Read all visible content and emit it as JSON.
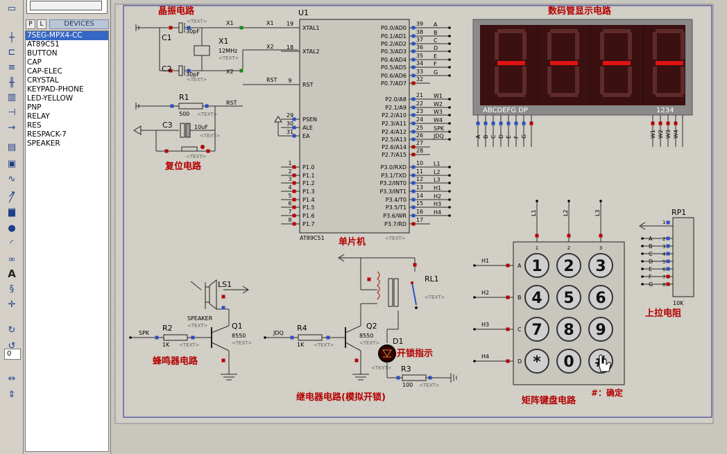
{
  "toolbar": {
    "icons": [
      "component-mode-icon",
      "junction-icon",
      "wire-label-icon",
      "text-script-icon",
      "bus-icon",
      "subcircuit-icon",
      "terminal-icon",
      "pin-icon",
      "graph-icon",
      "tape-icon",
      "generator-icon",
      "probe-icon",
      "virtual-instrument-icon",
      "line-icon",
      "box-icon",
      "circle-icon",
      "arc-icon",
      "path-icon",
      "text-icon",
      "symbol-icon",
      "marker-icon",
      "rotate-cw-icon",
      "rotate-ccw-icon",
      "flip-horizontal-icon",
      "flip-vertical-icon"
    ],
    "text_icon_label": "A",
    "rotation_value": "0"
  },
  "device_panel": {
    "tab_p": "P",
    "tab_l": "L",
    "title": "DEVICES",
    "devices": [
      "7SEG-MPX4-CC",
      "AT89C51",
      "BUTTON",
      "CAP",
      "CAP-ELEC",
      "CRYSTAL",
      "KEYPAD-PHONE",
      "LED-YELLOW",
      "PNP",
      "RELAY",
      "RES",
      "RESPACK-7",
      "SPEAKER"
    ],
    "selected_index": 0
  },
  "schematic": {
    "section_labels": {
      "crystal": "晶振电路",
      "display": "数码管显示电路",
      "reset": "复位电路",
      "mcu": "单片机",
      "buzzer": "蜂鸣器电路",
      "relay": "继电器电路(模拟开锁)",
      "keypad": "矩阵键盘电路",
      "pullup": "上拉电阻",
      "confirm": "#：确定",
      "led_indicator": "开锁指示"
    },
    "text_placeholder": "<TEXT>",
    "c1": {
      "ref": "C1",
      "value": "30pF"
    },
    "c2": {
      "ref": "C2",
      "value": "30pF"
    },
    "x1": {
      "ref": "X1",
      "value": "12MHz"
    },
    "r1": {
      "ref": "R1",
      "value": "500"
    },
    "c3": {
      "ref": "C3",
      "value": "10uF"
    },
    "net_x1": "X1",
    "net_x2": "X2",
    "net_rst": "RST",
    "mcu": {
      "ref": "U1",
      "part": "AT89C51",
      "left_pins": [
        {
          "num": "19",
          "name": "XTAL1",
          "net": "X1"
        },
        {
          "num": "18",
          "name": "XTAL2",
          "net": "X2"
        },
        {
          "num": "9",
          "name": "RST",
          "net": "RST"
        },
        {
          "num": "29",
          "name": "PSEN",
          "net": ""
        },
        {
          "num": "30",
          "name": "ALE",
          "net": ""
        },
        {
          "num": "31",
          "name": "EA",
          "net": ""
        },
        {
          "num": "1",
          "name": "P1.0",
          "net": ""
        },
        {
          "num": "2",
          "name": "P1.1",
          "net": ""
        },
        {
          "num": "3",
          "name": "P1.2",
          "net": ""
        },
        {
          "num": "4",
          "name": "P1.3",
          "net": ""
        },
        {
          "num": "5",
          "name": "P1.4",
          "net": ""
        },
        {
          "num": "6",
          "name": "P1.5",
          "net": ""
        },
        {
          "num": "7",
          "name": "P1.6",
          "net": ""
        },
        {
          "num": "8",
          "name": "P1.7",
          "net": ""
        }
      ],
      "right_pins": [
        {
          "num": "39",
          "name": "P0.0/AD0",
          "net": "A"
        },
        {
          "num": "38",
          "name": "P0.1/AD1",
          "net": "B"
        },
        {
          "num": "37",
          "name": "P0.2/AD2",
          "net": "C"
        },
        {
          "num": "36",
          "name": "P0.3/AD3",
          "net": "D"
        },
        {
          "num": "35",
          "name": "P0.4/AD4",
          "net": "E"
        },
        {
          "num": "34",
          "name": "P0.5/AD5",
          "net": "F"
        },
        {
          "num": "33",
          "name": "P0.6/AD6",
          "net": "G"
        },
        {
          "num": "32",
          "name": "P0.7/AD7",
          "net": ""
        },
        {
          "num": "21",
          "name": "P2.0/A8",
          "net": "W1"
        },
        {
          "num": "22",
          "name": "P2.1/A9",
          "net": "W2"
        },
        {
          "num": "23",
          "name": "P2.2/A10",
          "net": "W3"
        },
        {
          "num": "24",
          "name": "P2.3/A11",
          "net": "W4"
        },
        {
          "num": "25",
          "name": "P2.4/A12",
          "net": "SPK"
        },
        {
          "num": "26",
          "name": "P2.5/A13",
          "net": "JDQ"
        },
        {
          "num": "27",
          "name": "P2.6/A14",
          "net": ""
        },
        {
          "num": "28",
          "name": "P2.7/A15",
          "net": ""
        },
        {
          "num": "10",
          "name": "P3.0/RXD",
          "net": "L1"
        },
        {
          "num": "11",
          "name": "P3.1/TXD",
          "net": "L2"
        },
        {
          "num": "12",
          "name": "P3.2/INT0",
          "net": "L3"
        },
        {
          "num": "13",
          "name": "P3.3/INT1",
          "net": "H1"
        },
        {
          "num": "14",
          "name": "P3.4/T0",
          "net": "H2"
        },
        {
          "num": "15",
          "name": "P3.5/T1",
          "net": "H3"
        },
        {
          "num": "16",
          "name": "P3.6/WR",
          "net": "H4"
        },
        {
          "num": "17",
          "name": "P3.7/RD",
          "net": ""
        }
      ]
    },
    "display": {
      "digits": [
        "8",
        "8",
        "8",
        "8"
      ],
      "seg_label": "ABCDEFG  DP",
      "digit_label": "1234",
      "seg_nets": [
        "A",
        "B",
        "C",
        "D",
        "E",
        "F",
        "G"
      ],
      "digit_nets": [
        "W1",
        "W2",
        "W3",
        "W4"
      ],
      "colors": {
        "body": "#8a8a8a",
        "unlit": "#5e2a2a",
        "lit": "#e01414",
        "bg": "#3a1010"
      }
    },
    "buzzer": {
      "ls": {
        "ref": "LS1",
        "part": "SPEAKER"
      },
      "r": {
        "ref": "R2",
        "value": "1K"
      },
      "q": {
        "ref": "Q1",
        "part": "8550"
      },
      "net": "SPK"
    },
    "relay": {
      "rl": {
        "ref": "RL1"
      },
      "r": {
        "ref": "R4",
        "value": "1K"
      },
      "q": {
        "ref": "Q2",
        "part": "8550"
      },
      "led": {
        "ref": "D1"
      },
      "r3": {
        "ref": "R3",
        "value": "100"
      },
      "net": "JDQ"
    },
    "keypad": {
      "col_nets": [
        "L1",
        "L2",
        "L3"
      ],
      "col_nums": [
        "1",
        "2",
        "3"
      ],
      "row_nets": [
        "H1",
        "H2",
        "H3",
        "H4"
      ],
      "row_letters": [
        "A",
        "B",
        "C",
        "D"
      ],
      "keys": [
        "1",
        "2",
        "3",
        "4",
        "5",
        "6",
        "7",
        "8",
        "9",
        "*",
        "0",
        "#"
      ]
    },
    "rp1": {
      "ref": "RP1",
      "value": "10K",
      "pin1": "1",
      "pins": [
        {
          "net": "A",
          "num": "2"
        },
        {
          "net": "B",
          "num": "3"
        },
        {
          "net": "C",
          "num": "4"
        },
        {
          "net": "D",
          "num": "5"
        },
        {
          "net": "E",
          "num": "6"
        },
        {
          "net": "F",
          "num": "7"
        },
        {
          "net": "G",
          "num": "8"
        }
      ]
    }
  }
}
